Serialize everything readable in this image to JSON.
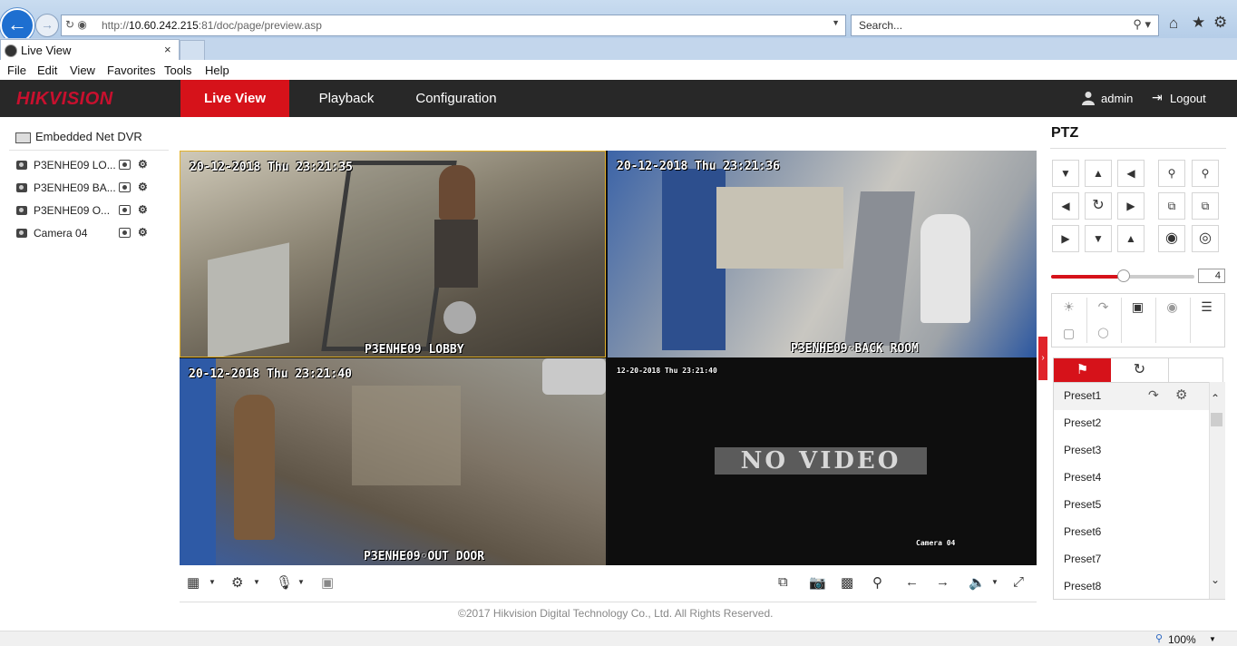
{
  "browser": {
    "url_prefix": "http://",
    "url_host": "10.60.242.215",
    "url_rest": ":81/doc/page/preview.asp",
    "search_placeholder": "Search...",
    "tab_title": "Live View",
    "tab_close": "×",
    "menu": [
      "File",
      "Edit",
      "View",
      "Favorites",
      "Tools",
      "Help"
    ],
    "zoom": "100%"
  },
  "app": {
    "logo": "HIKVISION",
    "nav": {
      "live": "Live View",
      "playback": "Playback",
      "config": "Configuration"
    },
    "user": "admin",
    "logout": "Logout"
  },
  "tree": {
    "root": "Embedded Net DVR",
    "cameras": [
      "P3ENHE09 LO...",
      "P3ENHE09 BA...",
      "P3ENHE09 O...",
      "Camera 04"
    ]
  },
  "video": {
    "cells": [
      {
        "timestamp": "20-12-2018 Thu 23:21:35",
        "name": "P3ENHE09 LOBBY"
      },
      {
        "timestamp": "20-12-2018 Thu 23:21:36",
        "name": "P3ENHE09◦BACK ROOM"
      },
      {
        "timestamp": "20-12-2018 Thu 23:21:40",
        "name": "P3ENHE09◦OUT DOOR"
      },
      {
        "timestamp": "12-20-2018 Thu 23:21:40",
        "name": "Camera 04",
        "no_video": "NO VIDEO"
      }
    ]
  },
  "footer": {
    "copyright": "©2017 Hikvision Digital Technology Co., Ltd. All Rights Reserved."
  },
  "ptz": {
    "title": "PTZ",
    "speed": "4",
    "speed_fraction": 0.5,
    "presets": [
      "Preset1",
      "Preset2",
      "Preset3",
      "Preset4",
      "Preset5",
      "Preset6",
      "Preset7",
      "Preset8"
    ]
  },
  "colors": {
    "brand_red": "#d6121a",
    "header_bg": "#282828",
    "selected_border": "#e2b12a"
  }
}
